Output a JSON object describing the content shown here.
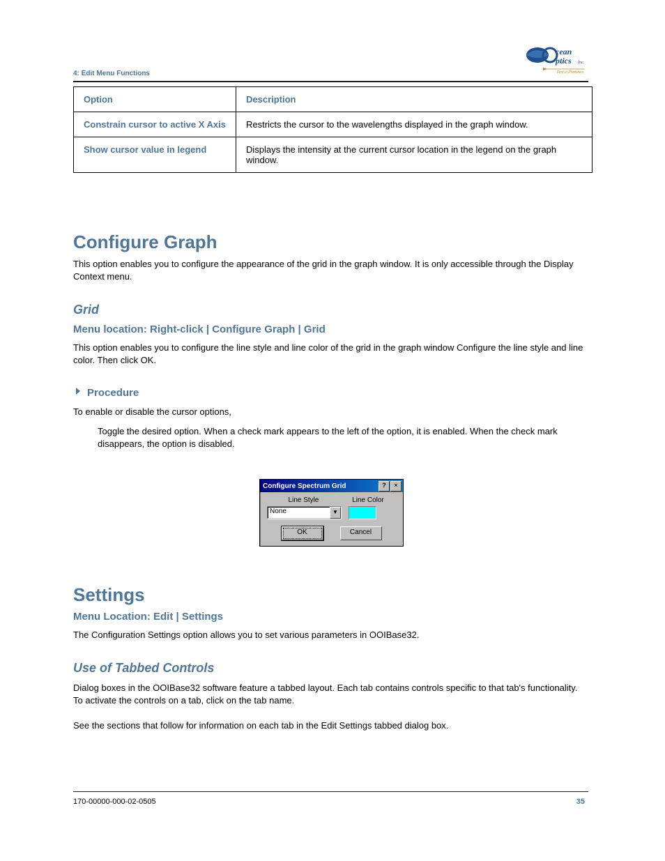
{
  "running_head": "4: Edit Menu Functions",
  "logo": {
    "top_text": "cean",
    "bottom_text": "ptics",
    "suffix": "Inc.",
    "tagline": "First in Photonics"
  },
  "table": {
    "headers": [
      "Option",
      "Description"
    ],
    "rows": [
      {
        "option": "Constrain cursor\nto active X Axis",
        "description": "Restricts the cursor to the wavelengths displayed in the graph window."
      },
      {
        "option": "Show cursor\nvalue in legend",
        "description": "Displays the intensity at the current cursor location in the legend on the graph window."
      }
    ]
  },
  "section1": {
    "heading": "Configure Graph",
    "text": "This option enables you to configure the appearance of the grid in the graph window. It is only accessible through the Display Context menu."
  },
  "section2": {
    "heading": "Grid",
    "sub": "Menu location: Right-click | Configure Graph | Grid",
    "text": "This option enables you to configure the line style and line color of the grid in the graph window Configure the line style and line color. Then click OK."
  },
  "section3": {
    "heading": "Procedure",
    "text1": "To enable or disable the cursor options,",
    "text2": "Toggle the desired option. When a check mark appears to the left of the option, it is enabled. When the check mark disappears, the option is disabled."
  },
  "dialog": {
    "title": "Configure Spectrum Grid",
    "help": "?",
    "close": "×",
    "line_style_label": "Line Style",
    "line_color_label": "Line Color",
    "combo_value": "None",
    "ok": "OK",
    "cancel": "Cancel"
  },
  "section4": {
    "heading": "Settings",
    "sub1": "Menu Location: Edit | Settings",
    "text1": "The Configuration Settings option allows you to set various parameters in OOIBase32.",
    "sub2": "Use of Tabbed Controls",
    "text2": "Dialog boxes in the OOIBase32 software feature a tabbed layout. Each tab contains controls specific to that tab's functionality. To activate the controls on a tab, click on the tab name.",
    "text3": "See the sections that follow for information on each tab in the Edit Settings tabbed dialog box."
  },
  "footer": {
    "left": "170-00000-000-02-0505",
    "right": "35"
  }
}
